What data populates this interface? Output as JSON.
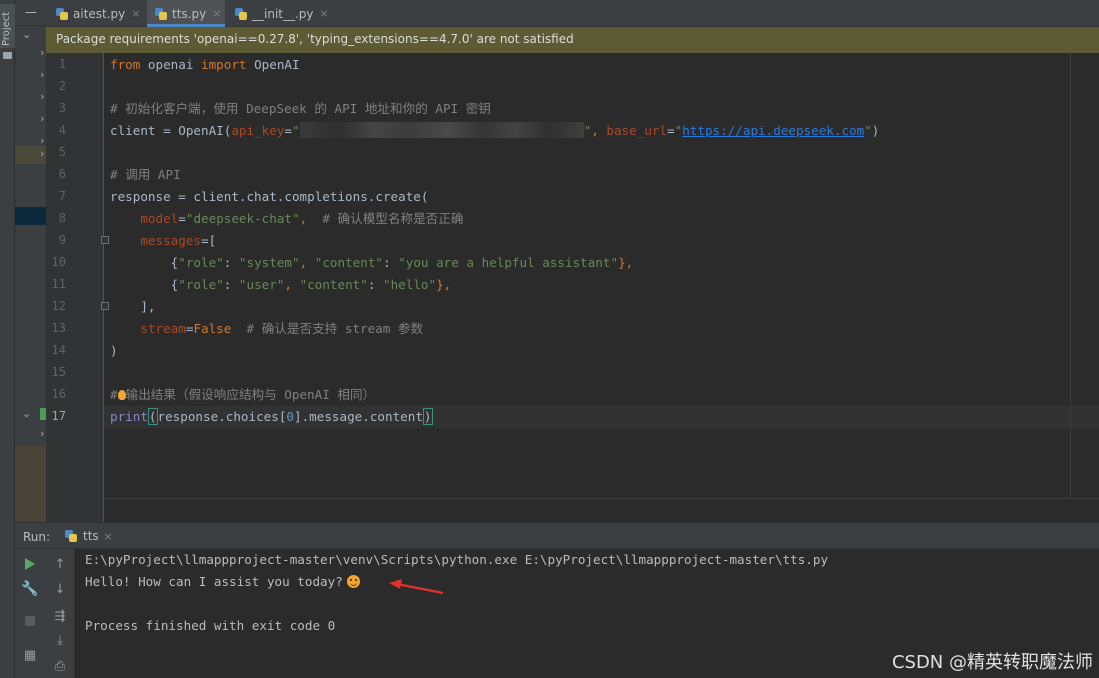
{
  "sidebar": {
    "project_tab": "Project"
  },
  "tabs": [
    {
      "label": "aitest.py",
      "close": "×"
    },
    {
      "label": "tts.py",
      "close": "×"
    },
    {
      "label": "__init__.py",
      "close": "×"
    }
  ],
  "banner": {
    "text": "Package requirements 'openai==0.27.8', 'typing_extensions==4.7.0' are not satisfied"
  },
  "editor": {
    "line_numbers": [
      "1",
      "2",
      "3",
      "4",
      "5",
      "6",
      "7",
      "8",
      "9",
      "10",
      "11",
      "12",
      "13",
      "14",
      "15",
      "16",
      "17"
    ],
    "current_line": "17",
    "code": {
      "l1": {
        "kw1": "from",
        "mod": " openai ",
        "kw2": "import",
        "name": " OpenAI"
      },
      "l3": {
        "comment": "# 初始化客户端，使用 DeepSeek 的 API 地址和你的 API 密钥"
      },
      "l4": {
        "pre": "client = OpenAI(",
        "param1": "api_key",
        "eq1": "=",
        "q1": "\"",
        "q2": "\"",
        "comma": ", ",
        "param2": "base_url",
        "eq2": "=",
        "str_open": "\"",
        "url": "https://api.deepseek.com",
        "str_close": "\"",
        "post": ")"
      },
      "l6": {
        "comment": "# 调用 API"
      },
      "l7": {
        "text": "response = client.chat.completions.create("
      },
      "l8": {
        "indent": "    ",
        "param": "model",
        "eq": "=",
        "str": "\"deepseek-chat\"",
        "comma": ",",
        "comment": "  # 确认模型名称是否正确"
      },
      "l9": {
        "indent": "    ",
        "param": "messages",
        "eq": "=["
      },
      "l10": {
        "indent": "        {",
        "k1": "\"role\"",
        "c1": ": ",
        "v1": "\"system\"",
        "sep": ", ",
        "k2": "\"content\"",
        "c2": ": ",
        "v2": "\"you are a helpful assistant\"",
        "end": "},"
      },
      "l11": {
        "indent": "        {",
        "k1": "\"role\"",
        "c1": ": ",
        "v1": "\"user\"",
        "sep": ", ",
        "k2": "\"content\"",
        "c2": ": ",
        "v2": "\"hello\"",
        "end": "},"
      },
      "l12": {
        "text": "    ],"
      },
      "l13": {
        "indent": "    ",
        "param": "stream",
        "eq": "=",
        "val": "False",
        "comment": "  # 确认是否支持 stream 参数"
      },
      "l14": {
        "text": ")"
      },
      "l16": {
        "hash": "#",
        "comment": "输出结果（假设响应结构与 OpenAI 相同）"
      },
      "l17": {
        "builtin": "print",
        "open": "(",
        "mid": "response.choices[",
        "num": "0",
        "tail": "].message.content",
        "close": ")"
      }
    }
  },
  "run": {
    "label": "Run:",
    "tab": "tts",
    "close": "×",
    "console": {
      "cmd": "E:\\pyProject\\llmappproject-master\\venv\\Scripts\\python.exe E:\\pyProject\\llmappproject-master\\tts.py",
      "output": "Hello! How can I assist you today?",
      "exit": "Process finished with exit code 0"
    }
  },
  "watermark": "CSDN @精英转职魔法师",
  "colors": {
    "banner": "#5c5b34",
    "accent": "#4a88c7",
    "arrow": "#e0312b"
  }
}
